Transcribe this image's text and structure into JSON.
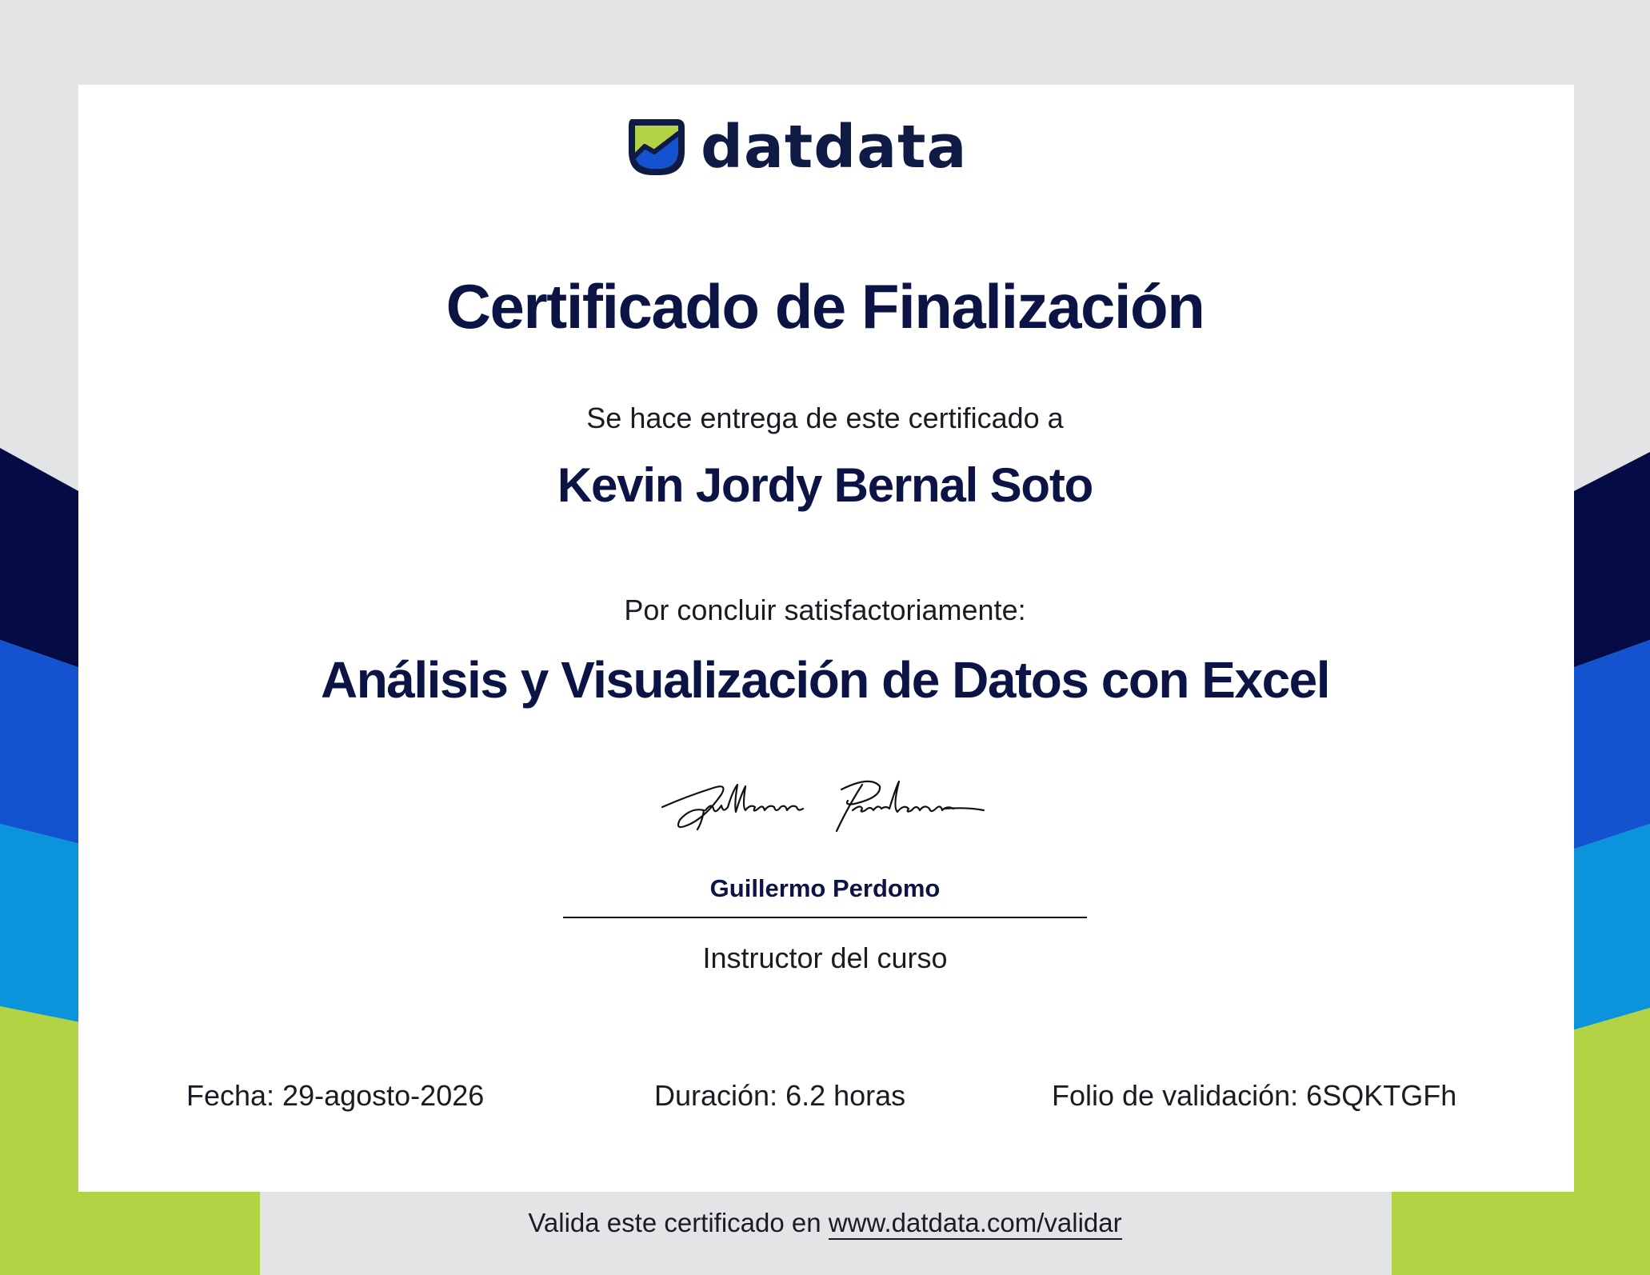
{
  "brand": {
    "name": "datdata",
    "logo_icon": "leaf-chart-icon",
    "colors": {
      "navy": "#050c45",
      "blue": "#1453d0",
      "cyan": "#0b93dc",
      "lime": "#b2d344",
      "text": "#0c1446"
    }
  },
  "certificate": {
    "title": "Certificado de Finalización",
    "presented_to_label": "Se hace entrega de este certificado a",
    "recipient": "Kevin Jordy Bernal Soto",
    "reason_label": "Por concluir satisfactoriamente:",
    "course": "Análisis y Visualización de Datos con Excel"
  },
  "instructor": {
    "signature_text": "Guillermo Perdomo",
    "name": "Guillermo Perdomo",
    "role": "Instructor del curso"
  },
  "details": {
    "fecha": "Fecha: 29-agosto-2026",
    "duracion": "Duración: 6.2 horas",
    "folio": "Folio de validación: 6SQKTGFh"
  },
  "footer": {
    "prefix": "Valida este certificado en",
    "link": "www.datdata.com/validar"
  }
}
